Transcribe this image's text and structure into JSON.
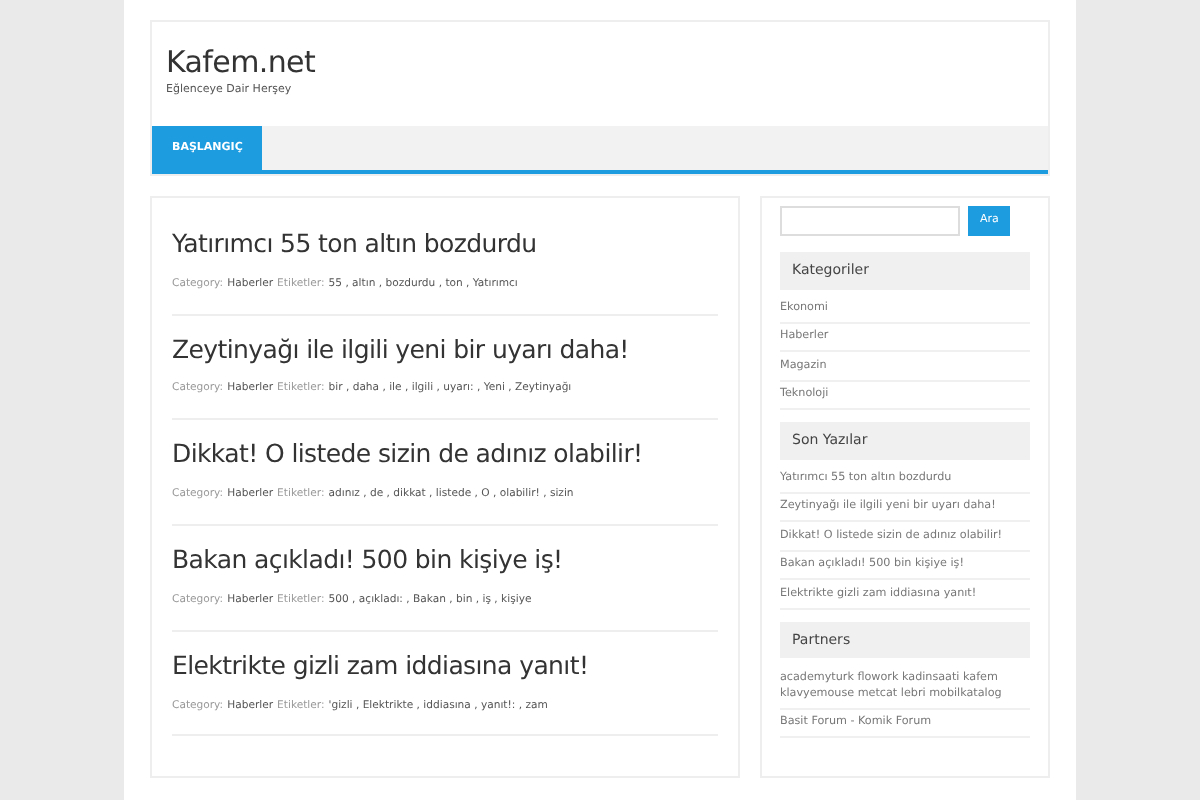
{
  "site": {
    "title": "Kafem.net",
    "tagline": "Eğlenceye Dair Herşey"
  },
  "nav": [
    {
      "label": "BAŞLANGIÇ",
      "selected": true
    }
  ],
  "posts": [
    {
      "title": "Yatırımcı 55 ton altın bozdurdu",
      "category_label": "Category:",
      "category": "Haberler",
      "tags_label": "Etiketler:",
      "tags": "55 , altın , bozdurdu , ton , Yatırımcı"
    },
    {
      "title": "Zeytinyağı ile ilgili yeni bir uyarı daha!",
      "category_label": "Category:",
      "category": "Haberler",
      "tags_label": "Etiketler:",
      "tags": "bir , daha , ile , ilgili , uyarı: , Yeni , Zeytinyağı"
    },
    {
      "title": "Dikkat! O listede sizin de adınız olabilir!",
      "category_label": "Category:",
      "category": "Haberler",
      "tags_label": "Etiketler:",
      "tags": "adınız , de , dikkat , listede , O , olabilir! , sizin"
    },
    {
      "title": "Bakan açıkladı! 500 bin kişiye iş!",
      "category_label": "Category:",
      "category": "Haberler",
      "tags_label": "Etiketler:",
      "tags": "500 , açıkladı: , Bakan , bin , iş , kişiye"
    },
    {
      "title": "Elektrikte gizli zam iddiasına yanıt!",
      "category_label": "Category:",
      "category": "Haberler",
      "tags_label": "Etiketler:",
      "tags": "'gizli , Elektrikte , iddiasına , yanıt!: , zam"
    }
  ],
  "sidebar": {
    "search": {
      "button": "Ara"
    },
    "widgets": [
      {
        "title": "Kategoriler",
        "links": [
          "Ekonomi",
          "Haberler",
          "Magazin",
          "Teknoloji"
        ]
      },
      {
        "title": "Son Yazılar",
        "links": [
          "Yatırımcı 55 ton altın bozdurdu",
          "Zeytinyağı ile ilgili yeni bir uyarı daha!",
          "Dikkat! O listede sizin de adınız olabilir!",
          "Bakan açıkladı! 500 bin kişiye iş!",
          "Elektrikte gizli zam iddiasına yanıt!"
        ]
      },
      {
        "title": "Partners",
        "links": [
          "academyturk flowork kadinsaati kafem klavyemouse metcat lebri mobilkatalog",
          "Basit Forum - Komik Forum"
        ]
      }
    ]
  }
}
